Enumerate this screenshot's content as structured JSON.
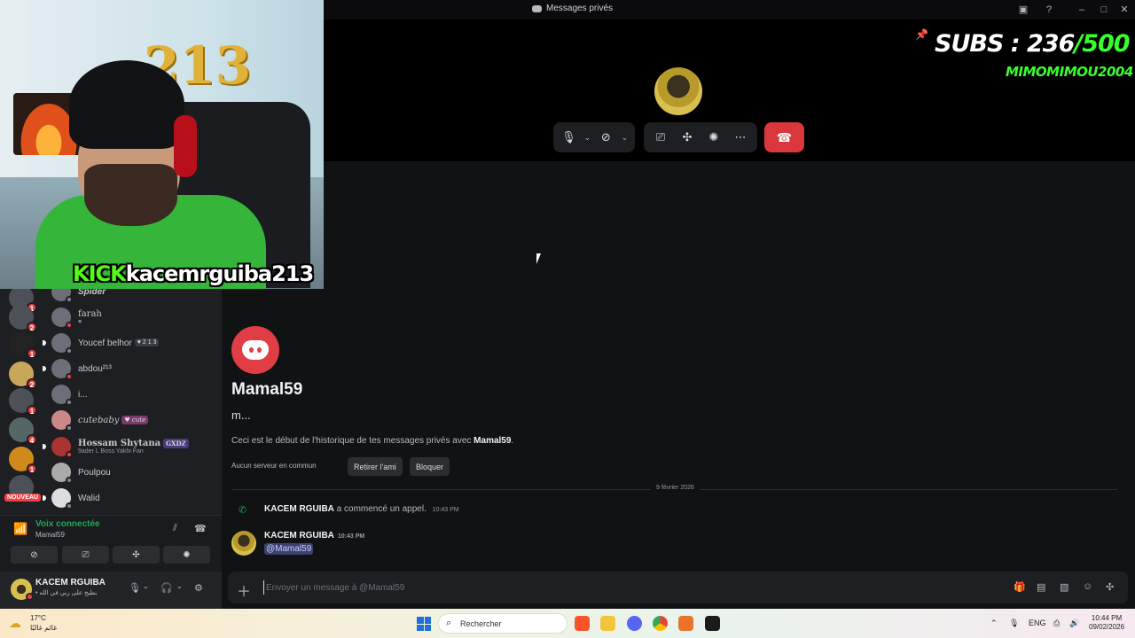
{
  "window": {
    "title": "Messages privés",
    "icons": [
      "inbox-icon",
      "help-icon",
      "minimize-icon",
      "maximize-icon",
      "close-icon"
    ]
  },
  "overlay": {
    "subs_prefix": "SUBS : ",
    "subs_count": "236",
    "subs_goal": "/500",
    "subs_user": "MIMOMIMOU2004",
    "cam_decor": "213",
    "kick_brand": "KICK",
    "kick_user": "kacemrguiba213"
  },
  "servers": [
    {
      "badge": "1"
    },
    {
      "badge": "2"
    },
    {
      "badge": "1"
    },
    {
      "badge": "2"
    },
    {
      "badge": "1"
    },
    {
      "badge": "4"
    },
    {
      "badge": "1"
    },
    {
      "badge": ""
    }
  ],
  "servers_new_label": "NOUVEAU",
  "dms": [
    {
      "name": "Spider",
      "sub": "",
      "tag": "",
      "status": "offline",
      "unread": false
    },
    {
      "name": "farah",
      "sub": "♥",
      "tag": "",
      "status": "dnd",
      "unread": false
    },
    {
      "name": "Youcef belhor",
      "sub": "",
      "tag": "♥ 2 1 3",
      "status": "offline",
      "unread": true
    },
    {
      "name": "abdou²¹³",
      "sub": "",
      "tag": "",
      "status": "dnd",
      "unread": true
    },
    {
      "name": "i...",
      "sub": "",
      "tag": "",
      "status": "offline",
      "unread": false
    },
    {
      "name": "cutebaby",
      "sub": "",
      "tag": "♥ cute",
      "status": "offline",
      "unread": false
    },
    {
      "name": "Hossam Shytana",
      "sub": "9ader L Boss Yakhi Fan",
      "tag": "GXDZ",
      "status": "dnd",
      "unread": true
    },
    {
      "name": "Poulpou",
      "sub": "",
      "tag": "",
      "status": "offline",
      "unread": false
    },
    {
      "name": "Walid",
      "sub": "",
      "tag": "",
      "status": "offline",
      "unread": true
    }
  ],
  "voice": {
    "title": "Voix connectée",
    "channel": "Mamal59"
  },
  "user": {
    "name": "KACEM RGUIBA",
    "status_text": "• بطيخ على ربي في الله"
  },
  "chat": {
    "intro_name": "Mamal59",
    "intro_handle": "m...",
    "intro_desc_prefix": "Ceci est le début de l'historique de tes messages privés avec ",
    "intro_desc_name": "Mamal59",
    "intro_desc_suffix": ".",
    "common_servers": "Aucun serveur en commun",
    "remove_friend": "Retirer l'ami",
    "block": "Bloquer",
    "date_divider": "9 février 2026",
    "sys_author": "KACEM RGUIBA",
    "sys_text": " a commencé un appel.",
    "sys_time": "10:43 PM",
    "msg_author": "KACEM RGUIBA",
    "msg_time": "10:43 PM",
    "msg_mention": "@Mamal59"
  },
  "composer": {
    "placeholder": "Envoyer un message à @Mamal59"
  },
  "taskbar": {
    "weather_temp": "17°C",
    "weather_desc": "غائم غالبًا",
    "search_label": "Rechercher",
    "discord_badge": "",
    "lang": "ENG",
    "time": "10:44 PM",
    "date": "09/02/2026"
  },
  "colors": {
    "accent": "#5865f2",
    "hangup": "#da373c",
    "connected": "#23a55a",
    "subs_goal": "#37ff2d"
  }
}
